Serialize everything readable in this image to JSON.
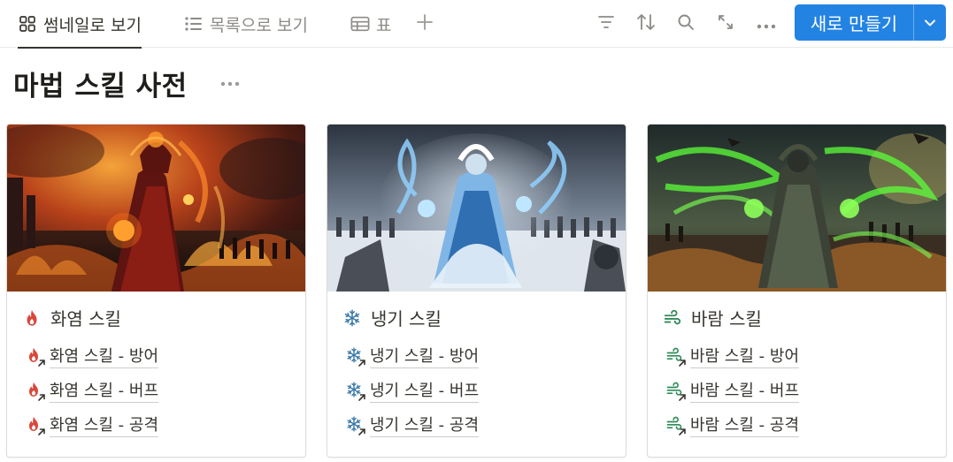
{
  "tabs": [
    {
      "label": "썸네일로 보기",
      "icon": "grid-icon",
      "active": true
    },
    {
      "label": "목록으로 보기",
      "icon": "list-icon",
      "active": false
    },
    {
      "label": "표",
      "icon": "table-icon",
      "active": false
    }
  ],
  "toolbar": {
    "add_view_icon": "plus-icon",
    "filter_icon": "filter-icon",
    "sort_icon": "sort-icon",
    "search_icon": "search-icon",
    "expand_icon": "expand-icon",
    "more_icon": "more-icon",
    "new_button_label": "새로 만들기"
  },
  "page": {
    "title": "마법 스킬 사전"
  },
  "colors": {
    "accent": "#2383e2",
    "fire": "#d9473b",
    "ice": "#3a78a6",
    "wind": "#2f8a5a"
  },
  "cards": [
    {
      "title": "화염 스킬",
      "icon": "fire-icon",
      "links": [
        "화염 스킬 - 방어",
        "화염 스킬 - 버프",
        "화염 스킬 - 공격"
      ]
    },
    {
      "title": "냉기 스킬",
      "icon": "snowflake-icon",
      "links": [
        "냉기 스킬 - 방어",
        "냉기 스킬 - 버프",
        "냉기 스킬 - 공격"
      ]
    },
    {
      "title": "바람 스킬",
      "icon": "wind-icon",
      "links": [
        "바람 스킬 - 방어",
        "바람 스킬 - 버프",
        "바람 스킬 - 공격"
      ]
    }
  ]
}
